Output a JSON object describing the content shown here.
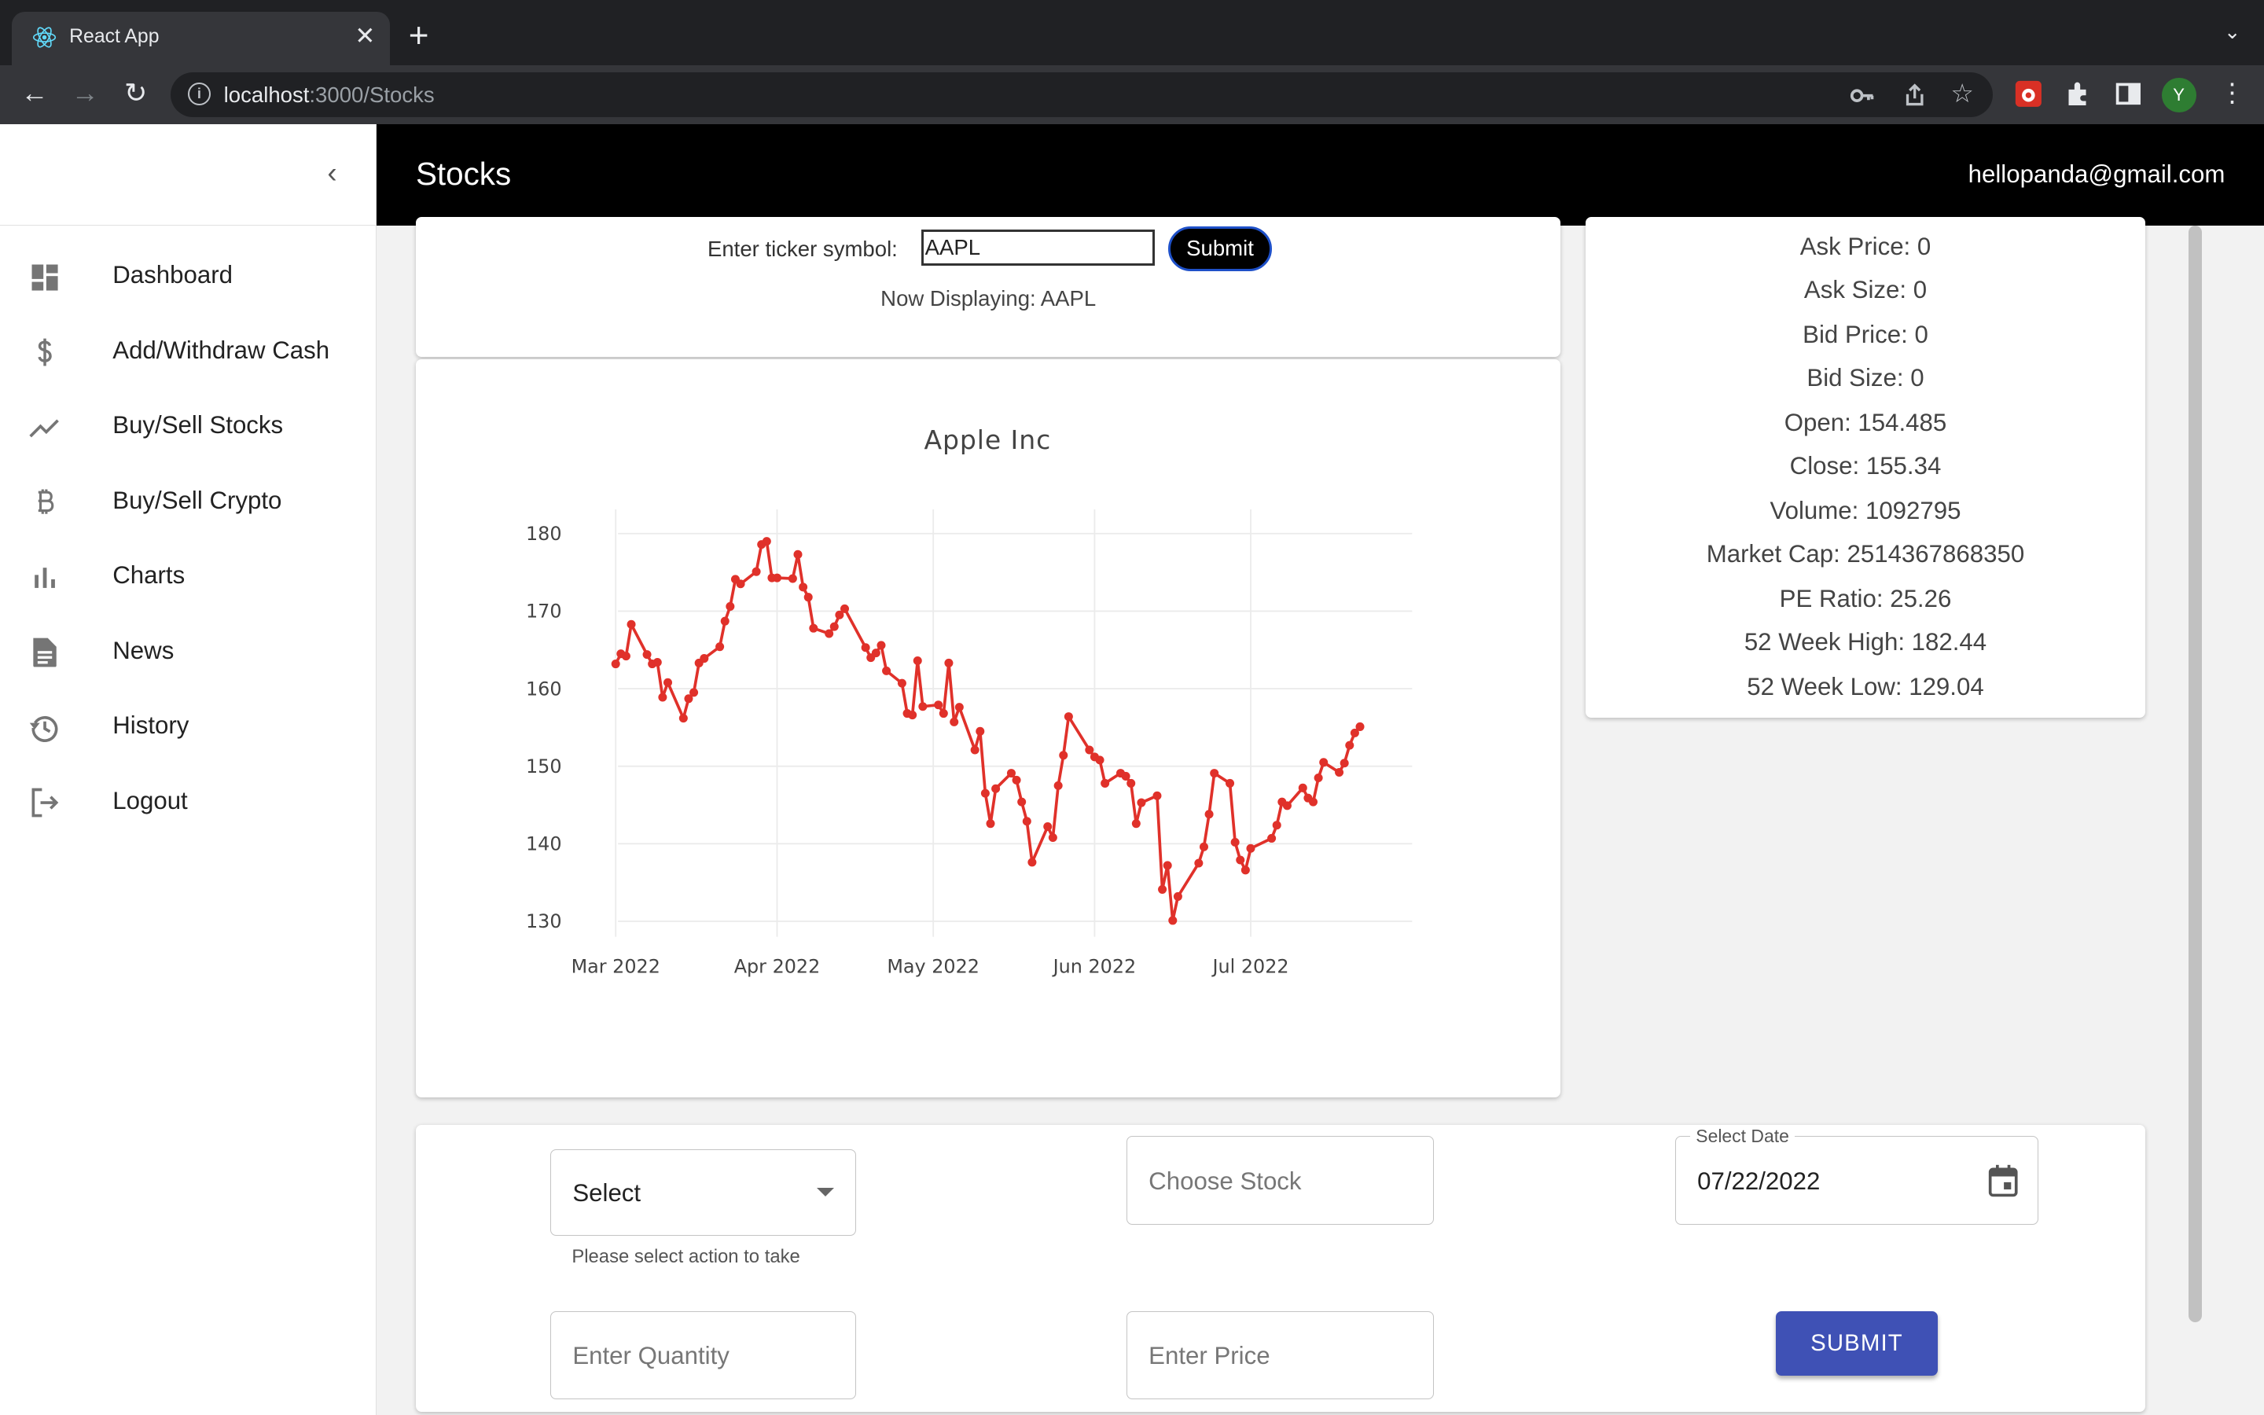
{
  "browser": {
    "tab_title": "React App",
    "tab_close": "✕",
    "new_tab": "+",
    "url_host": "localhost",
    "url_path": ":3000/Stocks",
    "profile_initial": "Y"
  },
  "sidebar": {
    "items": [
      {
        "label": "Dashboard",
        "icon": "dashboard-icon"
      },
      {
        "label": "Add/Withdraw Cash",
        "icon": "dollar-icon"
      },
      {
        "label": "Buy/Sell Stocks",
        "icon": "trending-up-icon"
      },
      {
        "label": "Buy/Sell Crypto",
        "icon": "bitcoin-icon"
      },
      {
        "label": "Charts",
        "icon": "bar-chart-icon"
      },
      {
        "label": "News",
        "icon": "article-icon"
      },
      {
        "label": "History",
        "icon": "history-icon"
      },
      {
        "label": "Logout",
        "icon": "logout-icon"
      }
    ]
  },
  "appbar": {
    "title": "Stocks",
    "user_email": "hellopanda@gmail.com"
  },
  "ticker": {
    "label": "Enter ticker symbol:",
    "value": "AAPL",
    "submit_label": "Submit",
    "now_displaying": "Now Displaying: AAPL"
  },
  "stats": [
    "Ask Price: 0",
    "Ask Size: 0",
    "Bid Price: 0",
    "Bid Size: 0",
    "Open: 154.485",
    "Close: 155.34",
    "Volume: 1092795",
    "Market Cap: 2514367868350",
    "PE Ratio: 25.26",
    "52 Week High: 182.44",
    "52 Week Low: 129.04"
  ],
  "chart_data": {
    "type": "line",
    "title": "Apple Inc",
    "xlabel": "",
    "ylabel": "",
    "x_ticks": [
      "Mar 2022",
      "Apr 2022",
      "May 2022",
      "Jun 2022",
      "Jul 2022"
    ],
    "y_ticks": [
      130,
      140,
      150,
      160,
      170,
      180
    ],
    "ylim": [
      128,
      182
    ],
    "xlim": [
      "2022-02-25",
      "2022-08-01"
    ],
    "grid": true,
    "color": "#e0312a",
    "series": [
      {
        "x": [
          "2022-03-01",
          "2022-03-02",
          "2022-03-03",
          "2022-03-04",
          "2022-03-07",
          "2022-03-08",
          "2022-03-09",
          "2022-03-10",
          "2022-03-11",
          "2022-03-14",
          "2022-03-15",
          "2022-03-16",
          "2022-03-17",
          "2022-03-18",
          "2022-03-21",
          "2022-03-22",
          "2022-03-23",
          "2022-03-24",
          "2022-03-25",
          "2022-03-28",
          "2022-03-29",
          "2022-03-30",
          "2022-03-31",
          "2022-04-01",
          "2022-04-04",
          "2022-04-05",
          "2022-04-06",
          "2022-04-07",
          "2022-04-08",
          "2022-04-11",
          "2022-04-12",
          "2022-04-13",
          "2022-04-14",
          "2022-04-18",
          "2022-04-19",
          "2022-04-20",
          "2022-04-21",
          "2022-04-22",
          "2022-04-25",
          "2022-04-26",
          "2022-04-27",
          "2022-04-28",
          "2022-04-29",
          "2022-05-02",
          "2022-05-03",
          "2022-05-04",
          "2022-05-05",
          "2022-05-06",
          "2022-05-09",
          "2022-05-10",
          "2022-05-11",
          "2022-05-12",
          "2022-05-13",
          "2022-05-16",
          "2022-05-17",
          "2022-05-18",
          "2022-05-19",
          "2022-05-20",
          "2022-05-23",
          "2022-05-24",
          "2022-05-25",
          "2022-05-26",
          "2022-05-27",
          "2022-05-31",
          "2022-06-01",
          "2022-06-02",
          "2022-06-03",
          "2022-06-06",
          "2022-06-07",
          "2022-06-08",
          "2022-06-09",
          "2022-06-10",
          "2022-06-13",
          "2022-06-14",
          "2022-06-15",
          "2022-06-16",
          "2022-06-17",
          "2022-06-21",
          "2022-06-22",
          "2022-06-23",
          "2022-06-24",
          "2022-06-27",
          "2022-06-28",
          "2022-06-29",
          "2022-06-30",
          "2022-07-01",
          "2022-07-05",
          "2022-07-06",
          "2022-07-07",
          "2022-07-08",
          "2022-07-11",
          "2022-07-12",
          "2022-07-13",
          "2022-07-14",
          "2022-07-15",
          "2022-07-18",
          "2022-07-19",
          "2022-07-20",
          "2022-07-21",
          "2022-07-22"
        ],
        "y": [
          163.2,
          164.5,
          164.2,
          168.3,
          164.4,
          163.2,
          163.4,
          158.9,
          160.8,
          156.2,
          158.7,
          159.5,
          163.3,
          163.9,
          165.4,
          168.7,
          170.6,
          174.1,
          173.5,
          175.1,
          178.6,
          179.0,
          174.3,
          174.3,
          174.2,
          177.3,
          173.1,
          171.8,
          167.8,
          167.1,
          168.0,
          169.5,
          170.3,
          165.3,
          164.0,
          164.6,
          165.6,
          162.3,
          160.7,
          156.8,
          156.6,
          163.6,
          157.7,
          157.9,
          156.8,
          163.3,
          155.7,
          157.6,
          152.1,
          154.5,
          146.5,
          142.6,
          147.1,
          149.1,
          148.2,
          145.4,
          142.9,
          137.6,
          142.2,
          140.8,
          147.5,
          151.4,
          156.4,
          152.1,
          151.2,
          150.8,
          147.8,
          149.1,
          148.7,
          147.8,
          142.6,
          145.3,
          146.2,
          134.1,
          137.2,
          130.1,
          133.2,
          137.5,
          139.6,
          143.8,
          149.1,
          147.8,
          140.2,
          137.9,
          136.6,
          139.4,
          140.7,
          142.4,
          145.4,
          144.9,
          147.2,
          145.9,
          145.4,
          148.5,
          150.5,
          149.2,
          150.4,
          152.7,
          154.3,
          155.1
        ]
      }
    ]
  },
  "trade_form": {
    "action_placeholder": "Select",
    "action_helper": "Please select action to take",
    "stock_placeholder": "Choose Stock",
    "date_label": "Select Date",
    "date_value": "07/22/2022",
    "quantity_placeholder": "Enter Quantity",
    "price_placeholder": "Enter Price",
    "submit_label": "SUBMIT"
  },
  "colors": {
    "appbar": "#000000",
    "submit_button": "#3f51b5",
    "chart_line": "#e0312a"
  }
}
